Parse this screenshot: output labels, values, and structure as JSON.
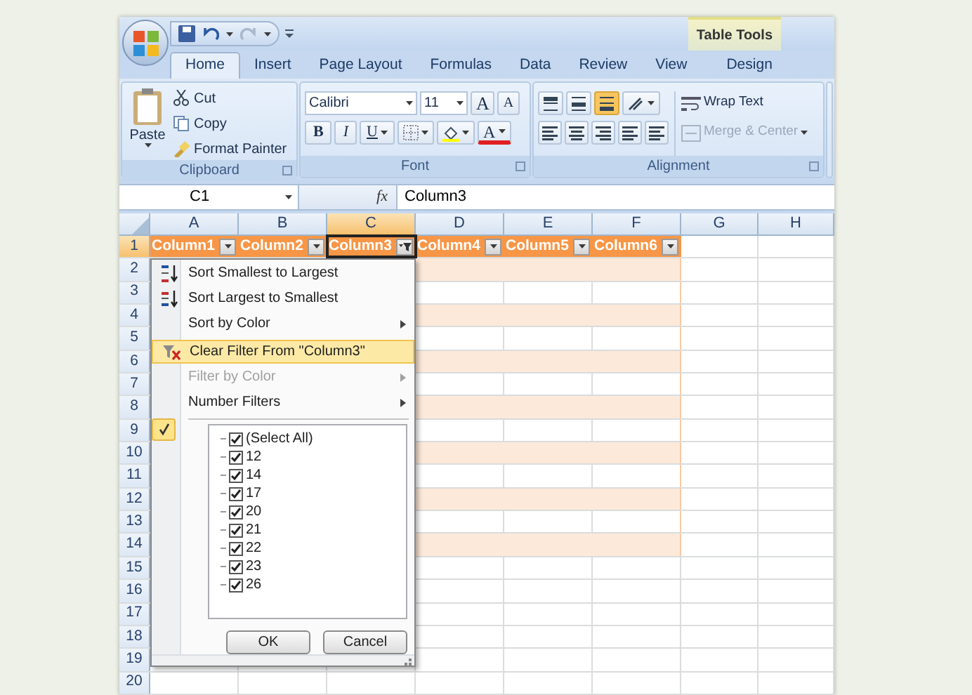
{
  "window": {
    "contextual_tab": "Table Tools"
  },
  "tabs": [
    {
      "label": "Home",
      "selected": true
    },
    {
      "label": "Insert",
      "selected": false
    },
    {
      "label": "Page Layout",
      "selected": false
    },
    {
      "label": "Formulas",
      "selected": false
    },
    {
      "label": "Data",
      "selected": false
    },
    {
      "label": "Review",
      "selected": false
    },
    {
      "label": "View",
      "selected": false
    },
    {
      "label": "Design",
      "selected": false
    }
  ],
  "ribbon": {
    "clipboard": {
      "label": "Clipboard",
      "paste": "Paste",
      "cut": "Cut",
      "copy": "Copy",
      "format_painter": "Format Painter"
    },
    "font": {
      "label": "Font",
      "name": "Calibri",
      "size": "11",
      "grow": "A",
      "shrink": "A",
      "bold": "B",
      "italic": "I",
      "underline": "U",
      "font_color": "A"
    },
    "alignment": {
      "label": "Alignment",
      "wrap_text": "Wrap Text",
      "merge": "Merge & Center",
      "merge_disabled": true
    }
  },
  "formula_bar": {
    "name_box": "C1",
    "function_label": "fx",
    "value": "Column3"
  },
  "sheet": {
    "columns": [
      {
        "label": "A",
        "selected": false
      },
      {
        "label": "B",
        "selected": false
      },
      {
        "label": "C",
        "selected": true
      },
      {
        "label": "D",
        "selected": false
      },
      {
        "label": "E",
        "selected": false
      },
      {
        "label": "F",
        "selected": false
      },
      {
        "label": "G",
        "selected": false
      },
      {
        "label": "H",
        "selected": false
      }
    ],
    "rows": [
      {
        "label": "1",
        "kind": "header",
        "selected": true
      },
      {
        "label": "2",
        "kind": "band",
        "selected": false
      },
      {
        "label": "3",
        "kind": "table",
        "selected": false
      },
      {
        "label": "4",
        "kind": "band",
        "selected": false
      },
      {
        "label": "5",
        "kind": "table",
        "selected": false
      },
      {
        "label": "6",
        "kind": "band",
        "selected": false
      },
      {
        "label": "7",
        "kind": "table",
        "selected": false
      },
      {
        "label": "8",
        "kind": "band",
        "selected": false
      },
      {
        "label": "9",
        "kind": "table",
        "selected": false
      },
      {
        "label": "10",
        "kind": "band",
        "selected": false
      },
      {
        "label": "11",
        "kind": "table",
        "selected": false
      },
      {
        "label": "12",
        "kind": "band",
        "selected": false
      },
      {
        "label": "13",
        "kind": "table",
        "selected": false
      },
      {
        "label": "14",
        "kind": "band",
        "selected": false
      },
      {
        "label": "15",
        "kind": "outside",
        "selected": false
      },
      {
        "label": "16",
        "kind": "outside",
        "selected": false
      },
      {
        "label": "17",
        "kind": "outside",
        "selected": false
      },
      {
        "label": "18",
        "kind": "outside",
        "selected": false
      },
      {
        "label": "19",
        "kind": "outside",
        "selected": false
      },
      {
        "label": "20",
        "kind": "outside",
        "selected": false
      }
    ],
    "headers": [
      {
        "label": "Column1",
        "filtered": false,
        "selected": false
      },
      {
        "label": "Column2",
        "filtered": false,
        "selected": false
      },
      {
        "label": "Column3",
        "filtered": true,
        "selected": true
      },
      {
        "label": "Column4",
        "filtered": false,
        "selected": false
      },
      {
        "label": "Column5",
        "filtered": false,
        "selected": false
      },
      {
        "label": "Column6",
        "filtered": false,
        "selected": false
      }
    ]
  },
  "filter_menu": {
    "items": [
      {
        "label": "Sort Smallest to Largest",
        "kind": "sort_asc",
        "disabled": false,
        "highlighted": false,
        "submenu": false
      },
      {
        "label": "Sort Largest to Smallest",
        "kind": "sort_desc",
        "disabled": false,
        "highlighted": false,
        "submenu": false
      },
      {
        "label": "Sort by Color",
        "kind": "plain",
        "disabled": false,
        "highlighted": false,
        "submenu": true
      },
      {
        "label": "Clear Filter From \"Column3\"",
        "kind": "clear_filter",
        "disabled": false,
        "highlighted": true,
        "submenu": false
      },
      {
        "label": "Filter by Color",
        "kind": "plain",
        "disabled": true,
        "highlighted": false,
        "submenu": true
      },
      {
        "label": "Number Filters",
        "kind": "plain",
        "disabled": false,
        "highlighted": false,
        "submenu": true
      }
    ],
    "values": [
      {
        "label": "(Select All)",
        "checked": true
      },
      {
        "label": "12",
        "checked": true
      },
      {
        "label": "14",
        "checked": true
      },
      {
        "label": "17",
        "checked": true
      },
      {
        "label": "20",
        "checked": true
      },
      {
        "label": "21",
        "checked": true
      },
      {
        "label": "22",
        "checked": true
      },
      {
        "label": "23",
        "checked": true
      },
      {
        "label": "26",
        "checked": true
      }
    ],
    "buttons": [
      "OK",
      "Cancel"
    ]
  }
}
